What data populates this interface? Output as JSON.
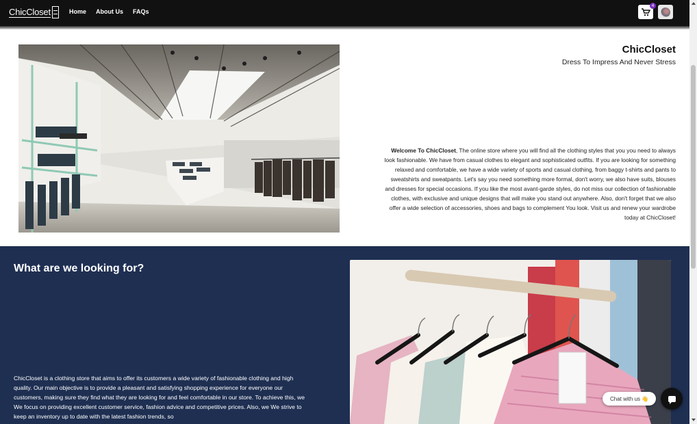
{
  "navbar": {
    "logo_text": "ChicCloset",
    "links": [
      "Home",
      "About Us",
      "FAQs"
    ],
    "cart_icon": "cart-icon",
    "cart_count": "4",
    "avatar_icon": "user-avatar"
  },
  "hero": {
    "image_icon": "store-interior-photo",
    "brand_title": "ChicCloset",
    "tagline": "Dress To Impress And Never Stress",
    "welcome_lead": "Welcome To ChicCloset",
    "welcome_body": ", The online store where you will find all the clothing styles that you you need to always look fashionable. We have from casual clothes to elegant and sophisticated outfits. If you are looking for something relaxed and comfortable, we have a wide variety of sports and casual clothing, from baggy t-shirts and pants to sweatshirts and sweatpants. Let's say you need something more formal, don't worry, we also have suits, blouses and dresses for special occasions. If you like the most avant-garde styles, do not miss our collection of fashionable clothes, with exclusive and unique designs that will make you stand out anywhere. Also, don't forget that we also offer a wide selection of accessories, shoes and bags to complement You look. Visit us and renew your wardrobe today at ChicCloset!"
  },
  "mission": {
    "title": "What are we looking for?",
    "body": "ChicCloset is a clothing store that aims to offer its customers a wide variety of fashionable clothing and high quality. Our main objective is to provide a pleasant and satisfying shopping experience for everyone our customers, making sure they find what they are looking for and feel comfortable in our store. To achieve this, we We focus on providing excellent customer service, fashion advice and competitive prices. Also, we We strive to keep an inventory up to date with the latest fashion trends, so",
    "image_icon": "clothing-rack-photo"
  },
  "chat": {
    "label": "Chat with us",
    "emoji": "👋",
    "icon": "chat-bubble-icon"
  },
  "colors": {
    "navbar": "#111111",
    "section_blue": "#1e2f52",
    "badge": "#7b2cbf"
  }
}
